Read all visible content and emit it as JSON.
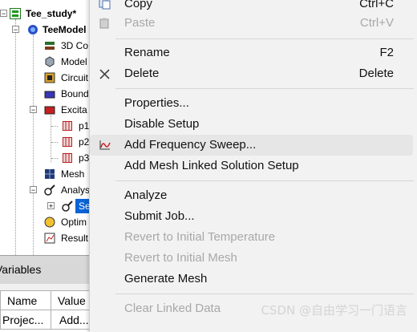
{
  "tree": {
    "project": "Tee_study*",
    "design": "TeeModel",
    "items": {
      "components": "3D Co",
      "model": "Model",
      "circuit": "Circuit",
      "boundaries": "Bound",
      "excitations": "Excita",
      "port1": "p1",
      "port2": "p2",
      "port3": "p3",
      "mesh": "Mesh",
      "analysis": "Analys",
      "setup": "Se",
      "optimetrics": "Optim",
      "results": "Result"
    }
  },
  "variables": {
    "title": "Variables",
    "col_name": "Name",
    "col_value": "Value",
    "row_name": "Projec...",
    "row_value": "Add..."
  },
  "menu": {
    "copy": {
      "label": "Copy",
      "shortcut": "Ctrl+C"
    },
    "paste": {
      "label": "Paste",
      "shortcut": "Ctrl+V"
    },
    "rename": {
      "label": "Rename",
      "shortcut": "F2"
    },
    "delete": {
      "label": "Delete",
      "shortcut": "Delete"
    },
    "properties": {
      "label": "Properties..."
    },
    "disable_setup": {
      "label": "Disable Setup"
    },
    "add_frequency_sweep": {
      "label": "Add Frequency Sweep..."
    },
    "add_mesh_linked": {
      "label": "Add Mesh Linked Solution Setup"
    },
    "analyze": {
      "label": "Analyze"
    },
    "submit_job": {
      "label": "Submit Job..."
    },
    "revert_initial_temperature": {
      "label": "Revert to Initial Temperature"
    },
    "revert_initial_mesh": {
      "label": "Revert to Initial Mesh"
    },
    "generate_mesh": {
      "label": "Generate Mesh"
    },
    "clear_linked_data": {
      "label": "Clear Linked Data"
    }
  },
  "watermark": "CSDN @自由学习一门语言",
  "colors": {
    "menu_bg": "#f2f2f2",
    "highlight": "#e6e6e6",
    "disabled_text": "#a8a8a8",
    "selection": "#0a64d6"
  },
  "icons": {
    "copy": "copy-icon",
    "paste": "paste-icon",
    "delete": "close-icon",
    "sweep": "frequency-sweep-icon"
  }
}
